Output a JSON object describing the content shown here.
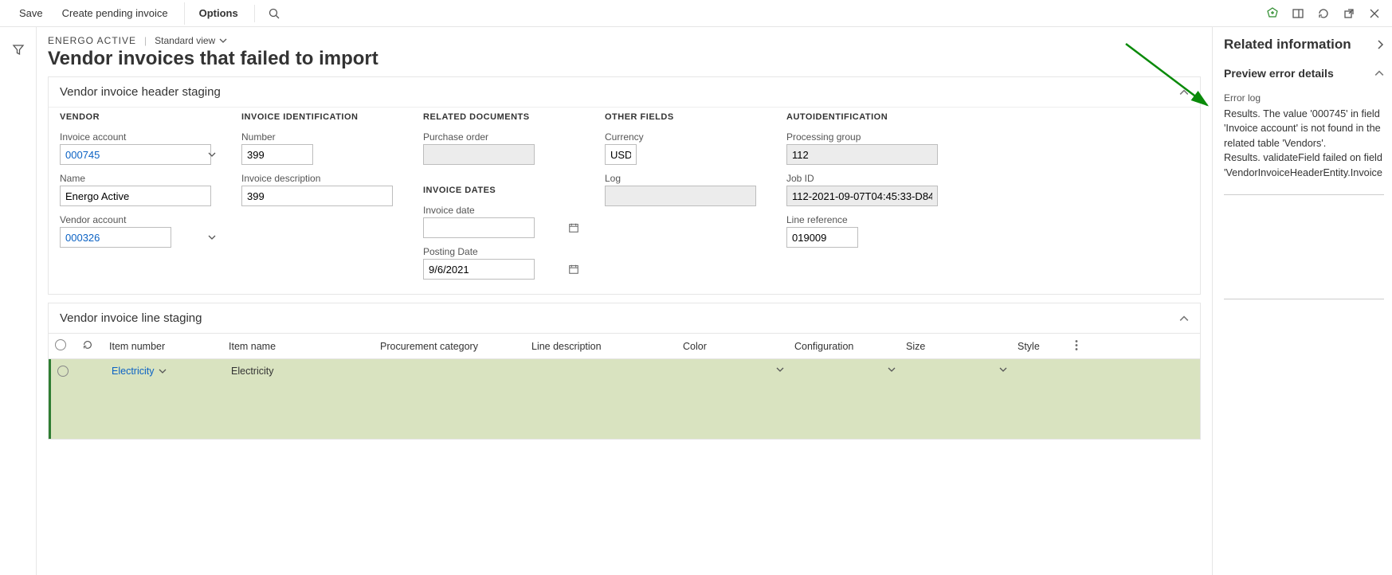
{
  "cmd": {
    "save": "Save",
    "create_pending": "Create pending invoice",
    "options": "Options"
  },
  "crumb": {
    "entity": "ENERGO ACTIVE",
    "view": "Standard view"
  },
  "page_title": "Vendor invoices that failed to import",
  "header_section_title": "Vendor invoice header staging",
  "line_section_title": "Vendor invoice line staging",
  "groups": {
    "vendor": "VENDOR",
    "invoice_id": "INVOICE IDENTIFICATION",
    "related_docs": "RELATED DOCUMENTS",
    "invoice_dates": "INVOICE DATES",
    "other": "OTHER FIELDS",
    "auto": "AUTOIDENTIFICATION"
  },
  "labels": {
    "invoice_account": "Invoice account",
    "name": "Name",
    "vendor_account": "Vendor account",
    "number": "Number",
    "invoice_desc": "Invoice description",
    "purchase_order": "Purchase order",
    "invoice_date": "Invoice date",
    "posting_date": "Posting Date",
    "currency": "Currency",
    "log": "Log",
    "processing_group": "Processing group",
    "job_id": "Job ID",
    "line_ref": "Line reference"
  },
  "values": {
    "invoice_account": "000745",
    "name": "Energo Active",
    "vendor_account": "000326",
    "number": "399",
    "invoice_desc": "399",
    "purchase_order": "",
    "invoice_date": "",
    "posting_date": "9/6/2021",
    "currency": "USD",
    "log": "",
    "processing_group": "112",
    "job_id": "112-2021-09-07T04:45:33-D847...",
    "line_ref": "019009"
  },
  "grid": {
    "cols": {
      "item_number": "Item number",
      "item_name": "Item name",
      "proc_cat": "Procurement category",
      "line_desc": "Line description",
      "color": "Color",
      "config": "Configuration",
      "size": "Size",
      "style": "Style"
    },
    "rows": [
      {
        "item_number": "Electricity",
        "item_name": "Electricity",
        "proc_cat": "",
        "line_desc": "",
        "color": "",
        "config": "",
        "size": "",
        "style": ""
      }
    ]
  },
  "side": {
    "title": "Related information",
    "preview_title": "Preview error details",
    "error_log_label": "Error log",
    "error_log_text": "Results. The value '000745' in field 'Invoice account' is not found in the related table 'Vendors'.\nResults. validateField failed on field 'VendorInvoiceHeaderEntity.Invoice"
  }
}
